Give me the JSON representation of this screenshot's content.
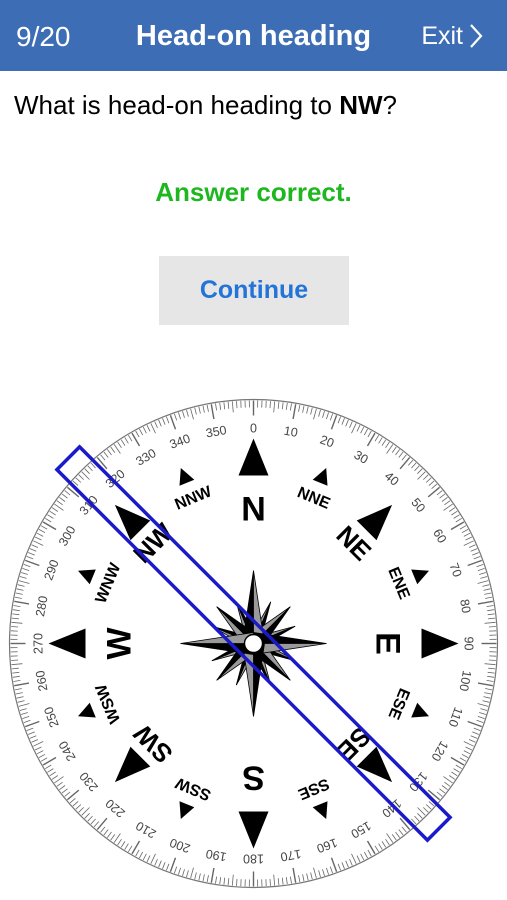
{
  "header": {
    "counter": "9/20",
    "title": "Head-on heading",
    "exit_label": "Exit",
    "background": "#3d6db5"
  },
  "question": {
    "prefix": "What is head-on heading to ",
    "direction": "NW",
    "suffix": "?"
  },
  "feedback": {
    "text": "Answer correct.",
    "color": "#1fb71f"
  },
  "continue_button": {
    "label": "Continue",
    "color": "#2374d8"
  },
  "compass": {
    "cardinals": [
      "N",
      "E",
      "S",
      "W"
    ],
    "intercardinals": [
      "NE",
      "SE",
      "SW",
      "NW"
    ],
    "secondary": [
      "NNE",
      "ENE",
      "ESE",
      "SSE",
      "SSW",
      "WSW",
      "WNW",
      "NNW"
    ],
    "degree_labels": [
      "0",
      "10",
      "20",
      "30",
      "40",
      "50",
      "60",
      "70",
      "80",
      "90",
      "100",
      "110",
      "120",
      "130",
      "140",
      "150",
      "160",
      "170",
      "180",
      "190",
      "200",
      "210",
      "220",
      "230",
      "240",
      "250",
      "260",
      "270",
      "280",
      "290",
      "300",
      "310",
      "320",
      "330",
      "340",
      "350"
    ],
    "highlight_heading_deg": 315,
    "highlight_color": "#1a1acc"
  }
}
